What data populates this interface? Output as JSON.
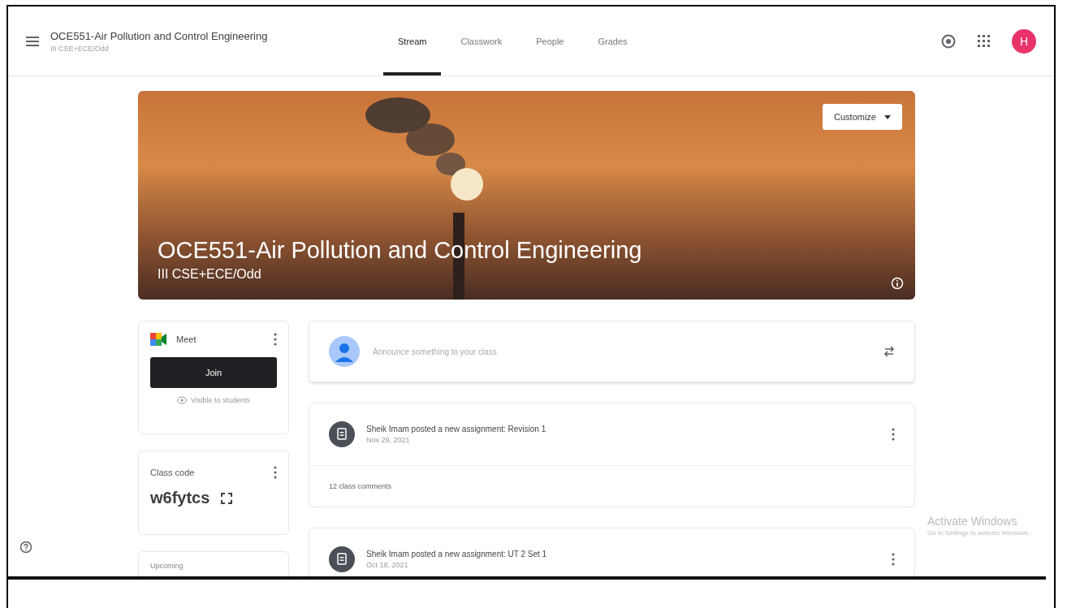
{
  "header": {
    "title": "OCE551-Air Pollution and Control Engineering",
    "subtitle": "III CSE+ECE/Odd",
    "avatar_letter": "H"
  },
  "tabs": [
    {
      "label": "Stream",
      "selected": true
    },
    {
      "label": "Classwork",
      "selected": false
    },
    {
      "label": "People",
      "selected": false
    },
    {
      "label": "Grades",
      "selected": false
    }
  ],
  "banner": {
    "title": "OCE551-Air Pollution and Control Engineering",
    "subtitle": "III CSE+ECE/Odd",
    "customize": "Customize"
  },
  "meet": {
    "label": "Meet",
    "join": "Join",
    "visibility": "Visible to students"
  },
  "class_code": {
    "label": "Class code",
    "code": "w6fytcs"
  },
  "upcoming": {
    "label": "Upcoming"
  },
  "announce": {
    "placeholder": "Announce something to your class"
  },
  "posts": [
    {
      "title": "Sheik Imam posted a new assignment: Revision 1",
      "date": "Nov 29, 2021",
      "comments": "12 class comments"
    },
    {
      "title": "Sheik Imam posted a new assignment: UT 2 Set 1",
      "date": "Oct 18, 2021"
    }
  ],
  "activation": {
    "title": "Activate Windows",
    "subtitle": "Go to Settings to activate Windows."
  }
}
